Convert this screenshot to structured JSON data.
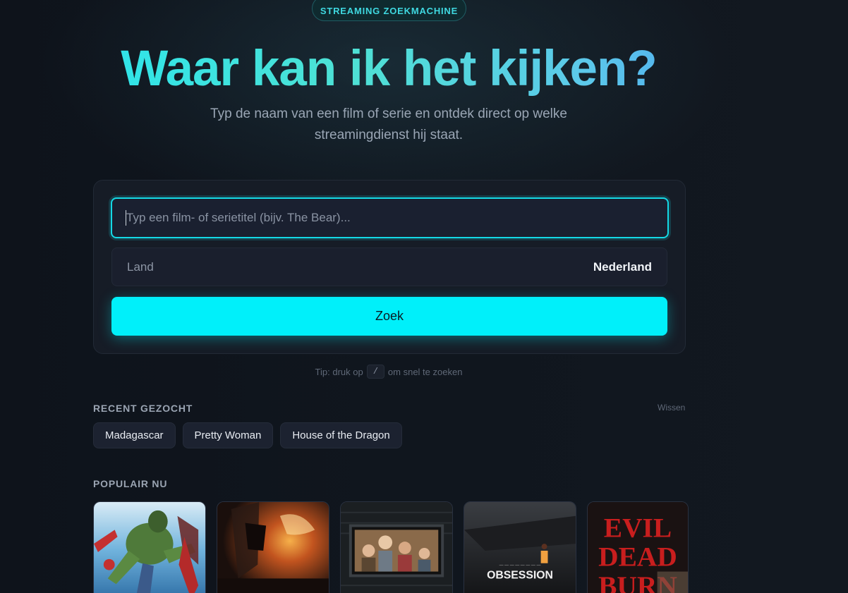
{
  "badge": "STREAMING ZOEKMACHINE",
  "hero": {
    "title": "Waar kan ik het kijken?",
    "subtitle": "Typ de naam van een film of serie en ontdek direct op welke streamingdienst hij staat."
  },
  "search": {
    "placeholder": "Typ een film- of serietitel (bijv. The Bear)...",
    "value": ""
  },
  "country": {
    "label": "Land",
    "value": "Nederland"
  },
  "search_button": "Zoek",
  "tip": {
    "before": "Tip: druk op",
    "key": "/",
    "after": "om snel te zoeken"
  },
  "recent": {
    "title": "RECENT GEZOCHT",
    "clear": "Wissen",
    "items": [
      "Madagascar",
      "Pretty Woman",
      "House of the Dragon"
    ]
  },
  "popular": {
    "title": "POPULAIR NU",
    "posters": [
      {
        "icon": "hulk-poster"
      },
      {
        "icon": "fire-poster"
      },
      {
        "icon": "family-window-poster"
      },
      {
        "icon": "obsession-poster",
        "text": "OBSESSION"
      },
      {
        "icon": "evil-dead-poster",
        "text": "EVIL DEAD BURN"
      }
    ]
  },
  "colors": {
    "accent": "#00f0fa",
    "background": "#0f141c",
    "card": "#161c26"
  }
}
